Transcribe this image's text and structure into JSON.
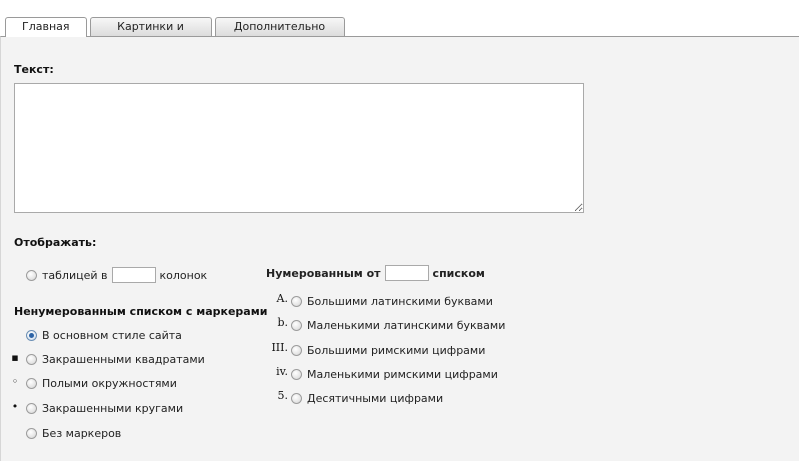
{
  "tabs": [
    {
      "label": "Главная",
      "active": true
    },
    {
      "label": "Картинки и файлы",
      "active": false
    },
    {
      "label": "Дополнительно",
      "active": false
    }
  ],
  "text_section": {
    "label": "Текст:",
    "value": ""
  },
  "display_section": {
    "label": "Отображать:",
    "table_option": {
      "prefix": "таблицей в",
      "columns_value": "",
      "suffix": "колонок"
    }
  },
  "unordered": {
    "label": "Ненумерованным списком с маркерами",
    "options": [
      {
        "marker": "",
        "label": "В основном стиле сайта",
        "checked": true
      },
      {
        "marker": "▪",
        "label": "Закрашенными квадратами",
        "checked": false
      },
      {
        "marker": "◦",
        "label": "Полыми окружностями",
        "checked": false
      },
      {
        "marker": "•",
        "label": "Закрашенными кругами",
        "checked": false
      },
      {
        "marker": "",
        "label": "Без маркеров",
        "checked": false
      }
    ]
  },
  "ordered": {
    "prefix": "Нумерованным от",
    "start_value": "",
    "suffix": "списком",
    "options": [
      {
        "marker": "A.",
        "label": "Большими латинскими буквами"
      },
      {
        "marker": "b.",
        "label": "Маленькими латинскими буквами"
      },
      {
        "marker": "III.",
        "label": "Большими римскими цифрами"
      },
      {
        "marker": "iv.",
        "label": "Маленькими римскими цифрами"
      },
      {
        "marker": "5.",
        "label": "Десятичными цифрами"
      }
    ]
  },
  "colors": {
    "panel_bg": "#f3f3f3",
    "border": "#9a9a9a",
    "radio_selected": "#2c63a6"
  }
}
